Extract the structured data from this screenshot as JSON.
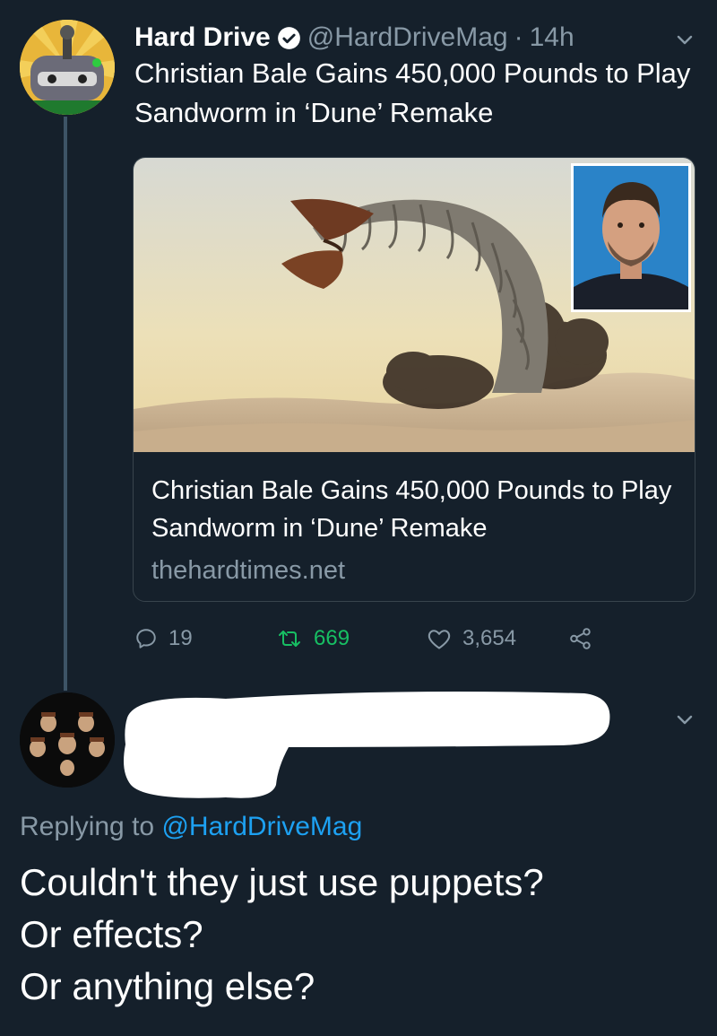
{
  "tweet": {
    "author": {
      "display_name": "Hard Drive",
      "handle": "@HardDriveMag",
      "separator": "·",
      "time": "14h",
      "verified": true
    },
    "text": "Christian Bale Gains 450,000 Pounds to Play Sandworm in ‘Dune’ Remake",
    "card": {
      "title": "Christian Bale Gains 450,000 Pounds to Play Sandworm in ‘Dune’ Remake",
      "domain": "thehardtimes.net"
    },
    "actions": {
      "replies": "19",
      "retweets": "669",
      "likes": "3,654"
    }
  },
  "reply": {
    "replying_prefix": "Replying to",
    "replying_to": "@HardDriveMag",
    "lines": [
      "Couldn't they just use puppets?",
      "Or effects?",
      "Or anything else?"
    ]
  },
  "icons": {
    "verified": "verified-badge-icon",
    "chevron": "chevron-down-icon",
    "reply": "reply-icon",
    "retweet": "retweet-icon",
    "like": "heart-icon",
    "share": "share-icon"
  },
  "colors": {
    "background": "#15202b",
    "secondary_text": "#8899a6",
    "link": "#1da1f2",
    "retweet_active": "#17bf63",
    "border": "#38444d"
  }
}
